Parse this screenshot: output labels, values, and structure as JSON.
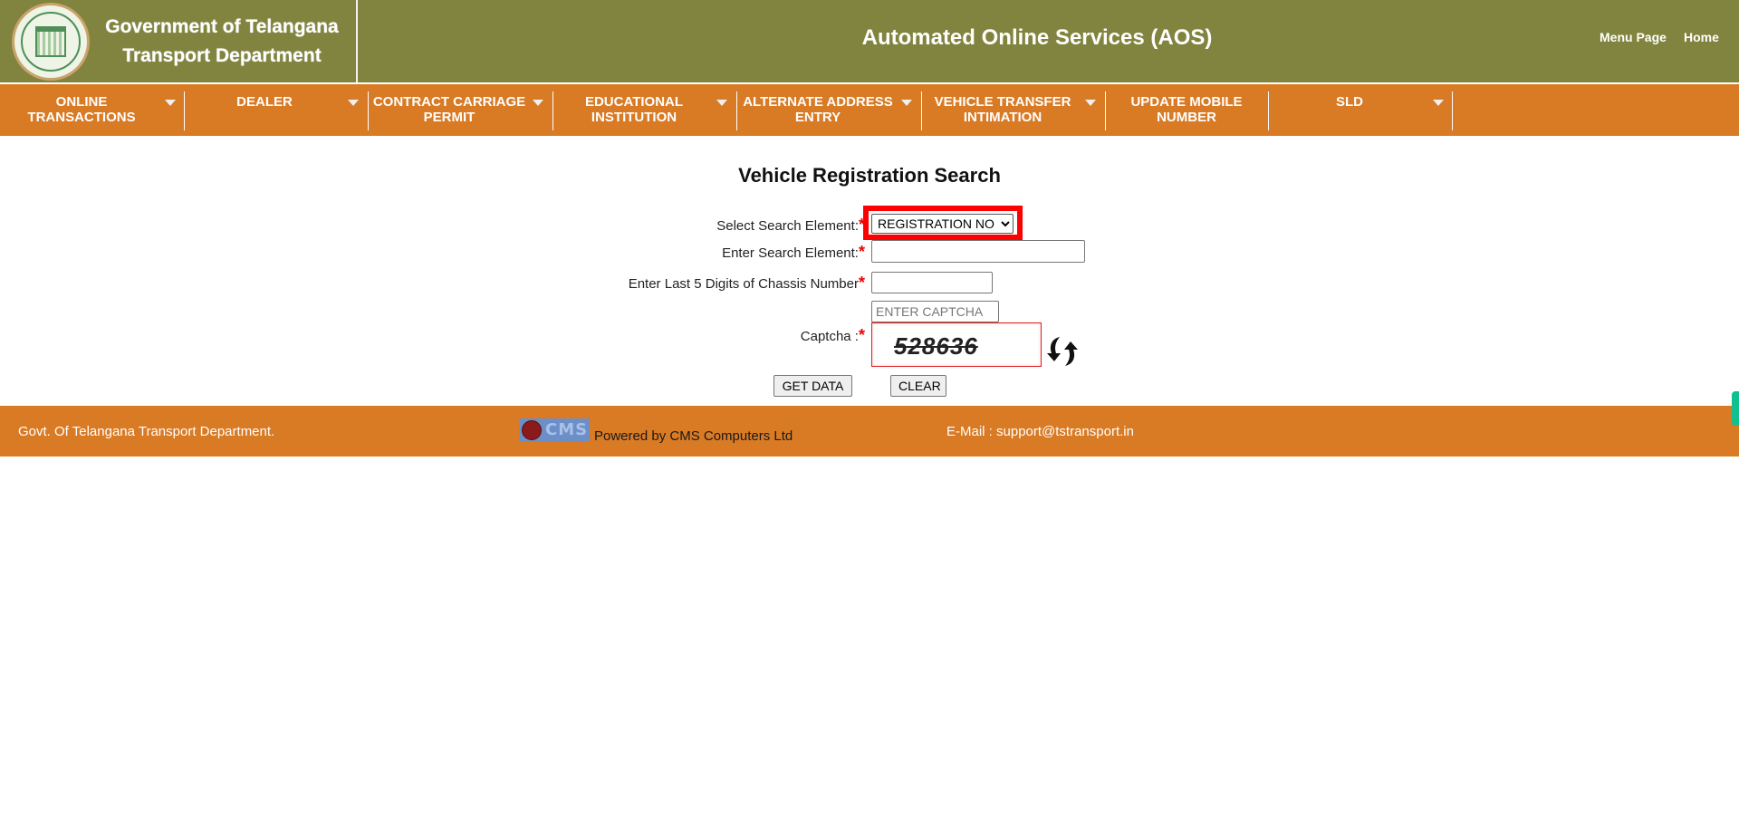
{
  "header": {
    "logo_icon": "telangana-emblem-icon",
    "gov_title_line1": "Government of Telangana",
    "gov_title_line2": "Transport Department",
    "app_title": "Automated Online Services (AOS)",
    "links": [
      {
        "label": "Menu Page"
      },
      {
        "label": "Home"
      }
    ]
  },
  "nav": {
    "items": [
      {
        "label": "ONLINE TRANSACTIONS",
        "has_dropdown": true
      },
      {
        "label": "DEALER",
        "has_dropdown": true
      },
      {
        "label": "CONTRACT CARRIAGE PERMIT",
        "has_dropdown": true
      },
      {
        "label": "EDUCATIONAL INSTITUTION",
        "has_dropdown": true
      },
      {
        "label": "ALTERNATE ADDRESS ENTRY",
        "has_dropdown": true
      },
      {
        "label": "VEHICLE TRANSFER INTIMATION",
        "has_dropdown": true
      },
      {
        "label": "UPDATE MOBILE NUMBER",
        "has_dropdown": false
      },
      {
        "label": "SLD",
        "has_dropdown": true
      }
    ]
  },
  "form": {
    "title": "Vehicle Registration Search",
    "required_marker": "*",
    "select_label": "Select Search Element:",
    "select_value": "REGISTRATION NO",
    "search_label": "Enter Search Element:",
    "search_value": "",
    "chassis_label": "Enter Last 5 Digits of Chassis Number",
    "chassis_value": "",
    "captcha_input_placeholder": "ENTER CAPTCHA",
    "captcha_label": "Captcha :",
    "captcha_code": "528636",
    "refresh_icon": "refresh-captcha-icon",
    "get_data_label": "GET DATA",
    "clear_label": "CLEAR"
  },
  "footer": {
    "left_text": "Govt. Of Telangana Transport Department.",
    "cms_logo_text": "CMS",
    "powered_text": "Powered by CMS Computers Ltd",
    "email_text": "E-Mail : support@tstransport.in"
  },
  "colors": {
    "header_bg": "#81843e",
    "nav_bg": "#d97a24",
    "highlight": "#ff0000",
    "side_tab": "#11c08e"
  }
}
